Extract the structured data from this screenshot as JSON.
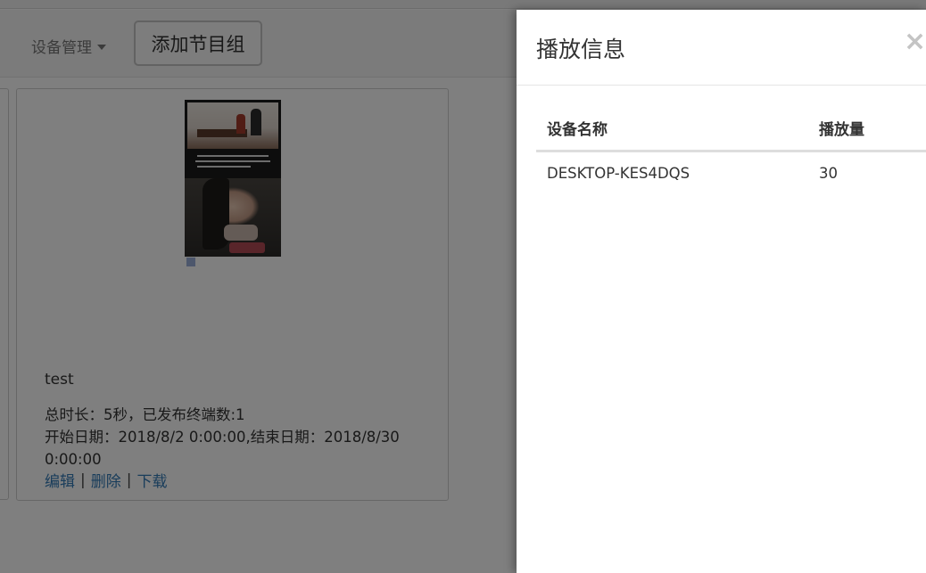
{
  "nav": {
    "device_menu": "设备管理",
    "add_group_button": "添加节目组"
  },
  "card": {
    "title": "test",
    "meta_line1": "总时长：5秒，已发布终端数:1",
    "meta_line2": "开始日期：2018/8/2 0:00:00,结束日期：2018/8/30 0:00:00",
    "actions": [
      "编辑",
      "删除",
      "下载"
    ],
    "separator": "|"
  },
  "panel": {
    "title": "播放信息",
    "close_icon": "×",
    "columns": [
      "设备名称",
      "播放量"
    ],
    "rows": [
      {
        "device": "DESKTOP-KES4DQS",
        "plays": "30"
      }
    ]
  },
  "colors": {
    "link": "#337ab7",
    "overlay": "rgba(0,0,0,0.5)"
  }
}
